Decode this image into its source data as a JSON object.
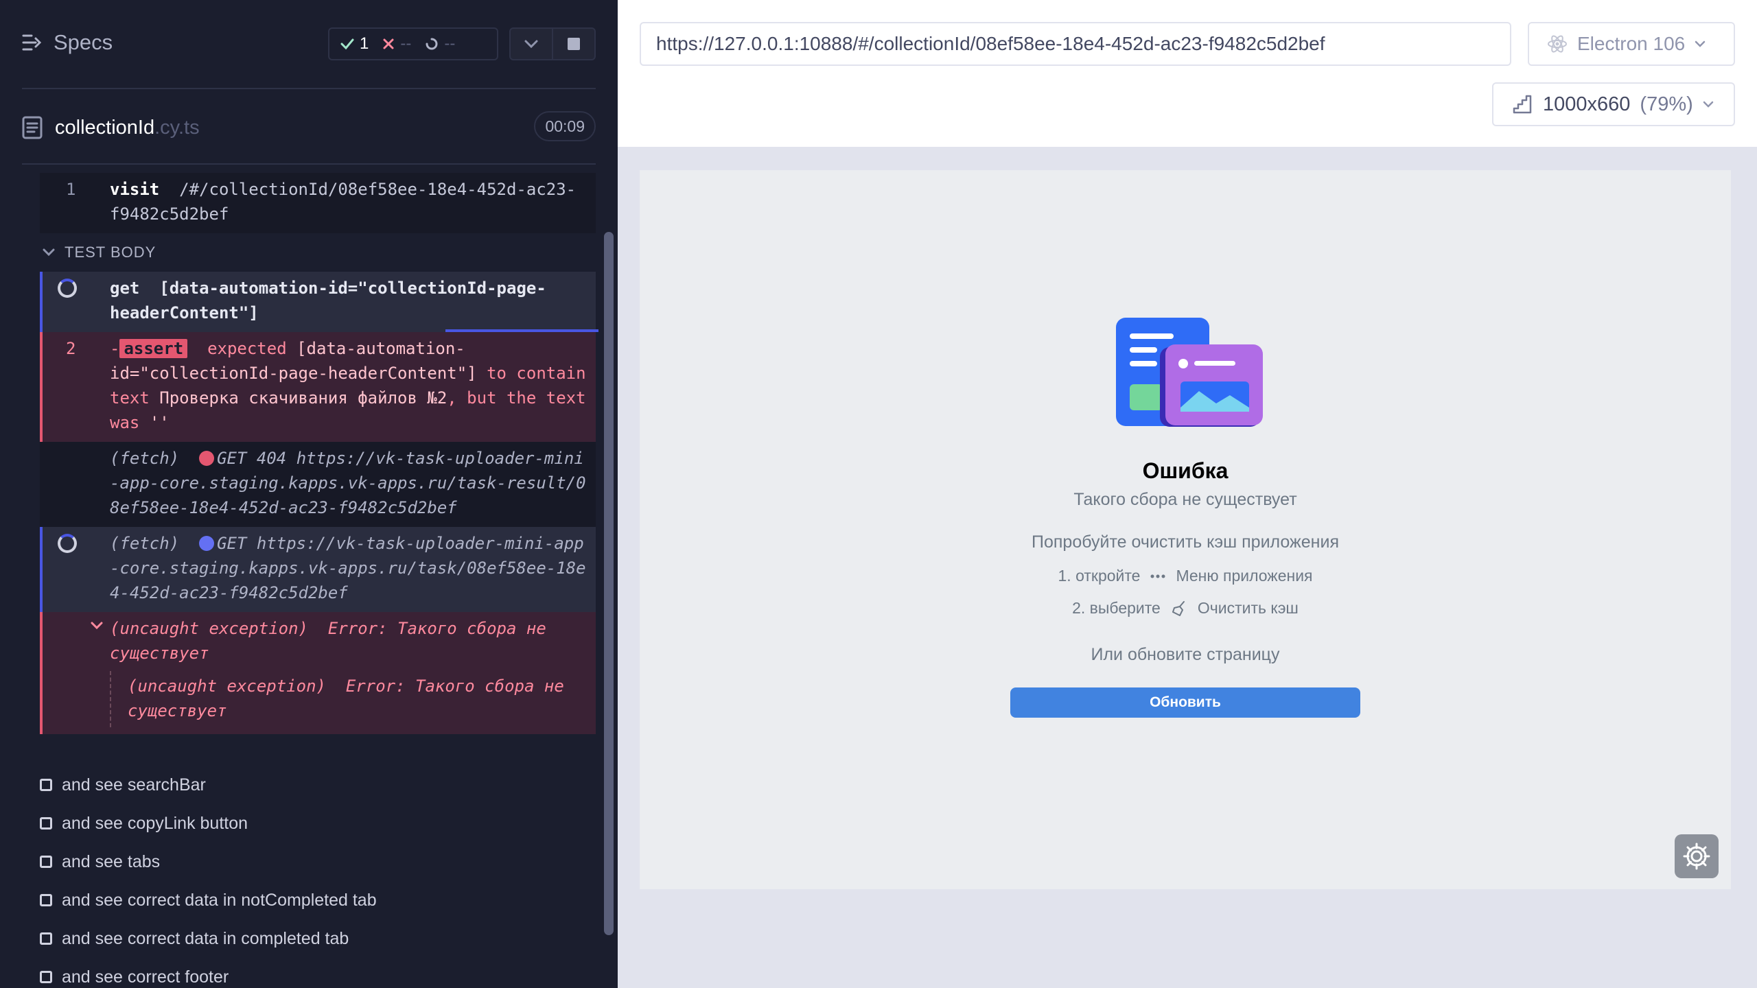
{
  "reporter": {
    "specs_label": "Specs",
    "stats": {
      "passed": "1",
      "failed": "--",
      "pending": "--"
    },
    "spec": {
      "name": "collectionId",
      "ext": ".cy.ts",
      "duration": "00:09"
    },
    "visit": {
      "num": "1",
      "command": "visit",
      "arg": "/#/collectionId/08ef58ee-18e4-452d-ac23-f9482c5d2bef"
    },
    "section": "TEST BODY",
    "get": {
      "command": "get",
      "arg": "[data-automation-id=\"collectionId-page-headerContent\"]"
    },
    "assert": {
      "num": "2",
      "prefix": "-",
      "badge": "assert",
      "t1": "expected",
      "t2": "[data-automation-id=\"collectionId-page-headerContent\"]",
      "t3": "to contain text",
      "t4": "Проверка скачивания файлов №2",
      "t5": ", but the text was",
      "t6": "''"
    },
    "fetch1": {
      "label": "(fetch)",
      "method": "GET",
      "status": "404",
      "url": "https://vk-task-uploader-mini-app-core.staging.kapps.vk-apps.ru/task-result/08ef58ee-18e4-452d-ac23-f9482c5d2bef",
      "dot_color": "#e45770"
    },
    "fetch2": {
      "label": "(fetch)",
      "method": "GET",
      "url": "https://vk-task-uploader-mini-app-core.staging.kapps.vk-apps.ru/task/08ef58ee-18e4-452d-ac23-f9482c5d2bef",
      "dot_color": "#6470f3"
    },
    "exception": {
      "label": "(uncaught exception)",
      "message": "Error: Такого сбора не существует"
    },
    "exception_nested": {
      "label": "(uncaught exception)",
      "message": "Error: Такого сбора не существует"
    },
    "tests": [
      "and see searchBar",
      "and see copyLink button",
      "and see tabs",
      "and see correct data in notCompleted tab",
      "and see correct data in completed tab",
      "and see correct footer"
    ]
  },
  "aut": {
    "url": "https://127.0.0.1:10888/#/collectionId/08ef58ee-18e4-452d-ac23-f9482c5d2bef",
    "browser": "Electron 106",
    "viewport": "1000x660",
    "zoom": "(79%)",
    "app": {
      "title": "Ошибка",
      "subtitle": "Такого сбора не существует",
      "hint": "Попробуйте очистить кэш приложения",
      "step1_prefix": "1. откройте",
      "step1_item": "Меню приложения",
      "step2_prefix": "2. выберите",
      "step2_item": "Очистить кэш",
      "or_text": "Или обновите страницу",
      "refresh_label": "Обновить"
    }
  },
  "colors": {
    "accent": "#4956e3",
    "fail": "#e45770",
    "pass": "#a3e7cb",
    "app_button": "#4183e0"
  }
}
